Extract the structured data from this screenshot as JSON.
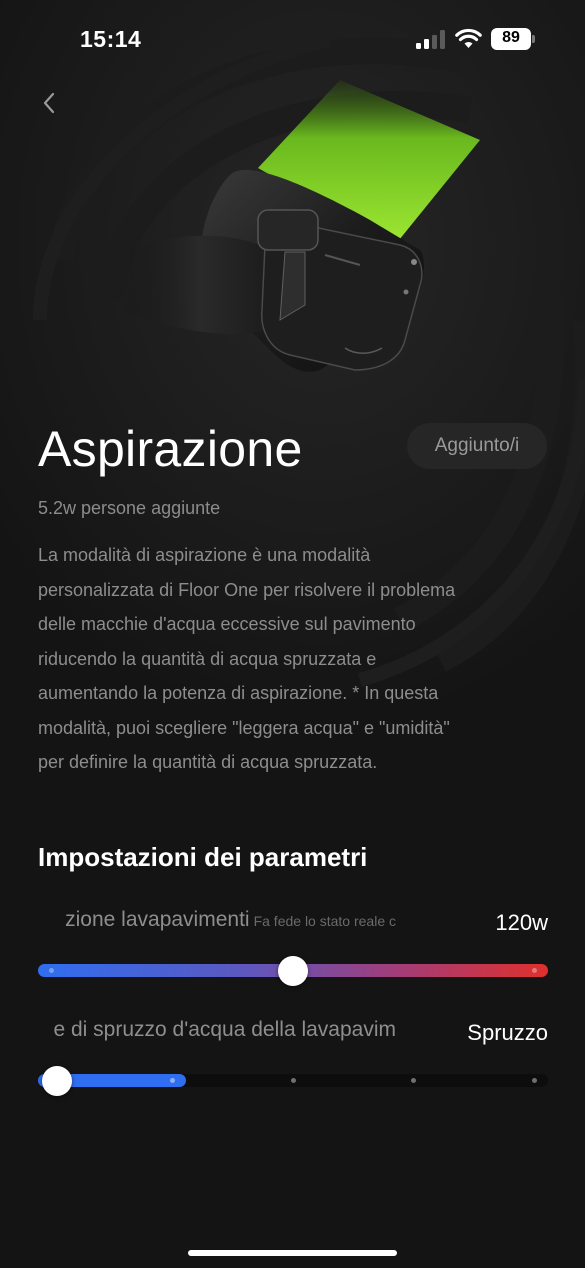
{
  "status_bar": {
    "time": "15:14",
    "battery_level": "89",
    "icons": [
      "signal-icon",
      "wifi-icon",
      "battery-icon"
    ]
  },
  "nav": {
    "back_icon": "chevron-left-icon"
  },
  "hero": {
    "image": "vacuum-brush-head-with-green-light"
  },
  "mode": {
    "title": "Aspirazione",
    "added_label": "Aggiunto/i",
    "users_count": "5.2w persone aggiunte",
    "description": "La modalità di aspirazione è una modalità personalizzata di Floor One per risolvere il problema delle macchie d'acqua eccessive sul pavimento riducendo la quantità di acqua spruzzata e aumentando la potenza di aspirazione. * In questa modalità, puoi scegliere \"leggera acqua\" e \"umidità\" per definire la quantità di acqua spruzzata."
  },
  "settings": {
    "section_title": "Impostazioni dei parametri",
    "suction": {
      "label": "zione lavapavimenti",
      "hint": "Fa fede lo stato reale c",
      "value": "120w",
      "level": 0.5,
      "colors": [
        "#2f6ef0",
        "#e0302c"
      ]
    },
    "spray": {
      "label": "e di spruzzo d'acqua della lavapavim",
      "value": "Spruzzo",
      "level": 0.0,
      "steps": 5,
      "fill_color": "#2f6ef0"
    }
  }
}
